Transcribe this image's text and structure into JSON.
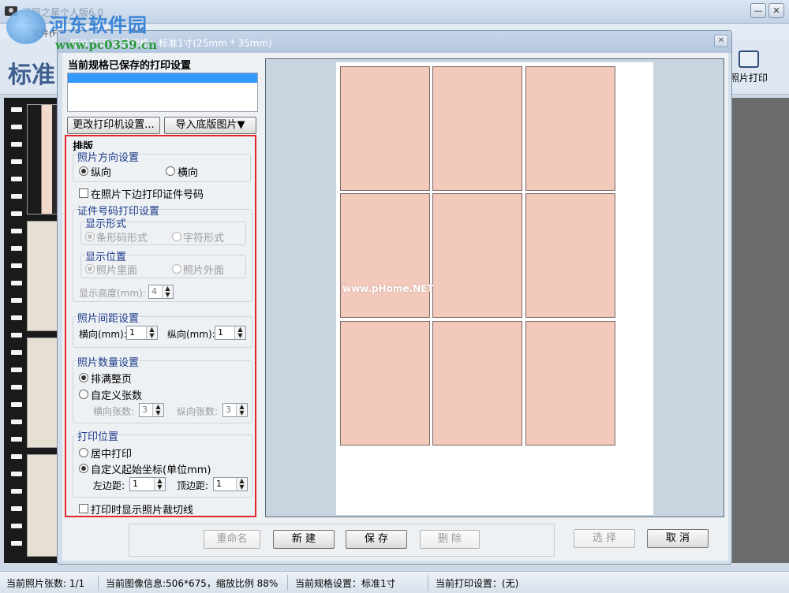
{
  "main_window": {
    "title": "证照之星个人版6.0",
    "menu_text": "文件(F)  编辑(E)  工具(T)  帮助(H)",
    "big_title": "标准",
    "print_tool_label": "照片打印",
    "minimize_glyph": "—",
    "close_glyph": "✕"
  },
  "watermark": {
    "site_name": "河东软件园",
    "url": "www.pc0359.cn",
    "preview_mark": "www.pHome.NET"
  },
  "dialog": {
    "title": "照片打印  当前规格：标准1寸(25mm * 35mm)",
    "close_glyph": "✕",
    "saved_settings_label": "当前规格已保存的打印设置",
    "change_printer_button": "更改打印机设置...",
    "import_base_button": "导入底版图片▼",
    "layout": {
      "section_title": "排版",
      "orientation": {
        "title": "照片方向设置",
        "portrait": "纵向",
        "landscape": "横向",
        "selected": "portrait"
      },
      "print_id_checkbox": "在照片下边打印证件号码",
      "id_print": {
        "title": "证件号码打印设置",
        "display_form": {
          "title": "显示形式",
          "barcode": "条形码形式",
          "text": "字符形式"
        },
        "display_position": {
          "title": "显示位置",
          "inside": "照片里面",
          "outside": "照片外面"
        },
        "height_label": "显示高度(mm):",
        "height_value": "4"
      },
      "spacing": {
        "title": "照片间距设置",
        "h_label": "横向(mm):",
        "h_value": "1",
        "v_label": "纵向(mm):",
        "v_value": "1"
      },
      "count": {
        "title": "照片数量设置",
        "fill_page": "排满整页",
        "custom": "自定义张数",
        "h_count_label": "横向张数:",
        "h_count_value": "3",
        "v_count_label": "纵向张数:",
        "v_count_value": "3"
      },
      "position": {
        "title": "打印位置",
        "center": "居中打印",
        "custom": "自定义起始坐标(单位mm)",
        "left_label": "左边距:",
        "left_value": "1",
        "top_label": "顶边距:",
        "top_value": "1"
      },
      "cut_lines_checkbox": "打印时显示照片裁切线"
    },
    "buttons": {
      "rename": "重命名",
      "new": "新 建",
      "save": "保 存",
      "delete": "删 除",
      "select": "选 择",
      "cancel": "取 消"
    },
    "preview": {
      "rows": 3,
      "cols": 3
    }
  },
  "status_bar": {
    "photo_count": "当前照片张数: 1/1",
    "image_info": "当前图像信息:506*675，缩放比例 88%",
    "spec": "当前规格设置：标准1寸",
    "print_setting": "当前打印设置：(无)"
  }
}
